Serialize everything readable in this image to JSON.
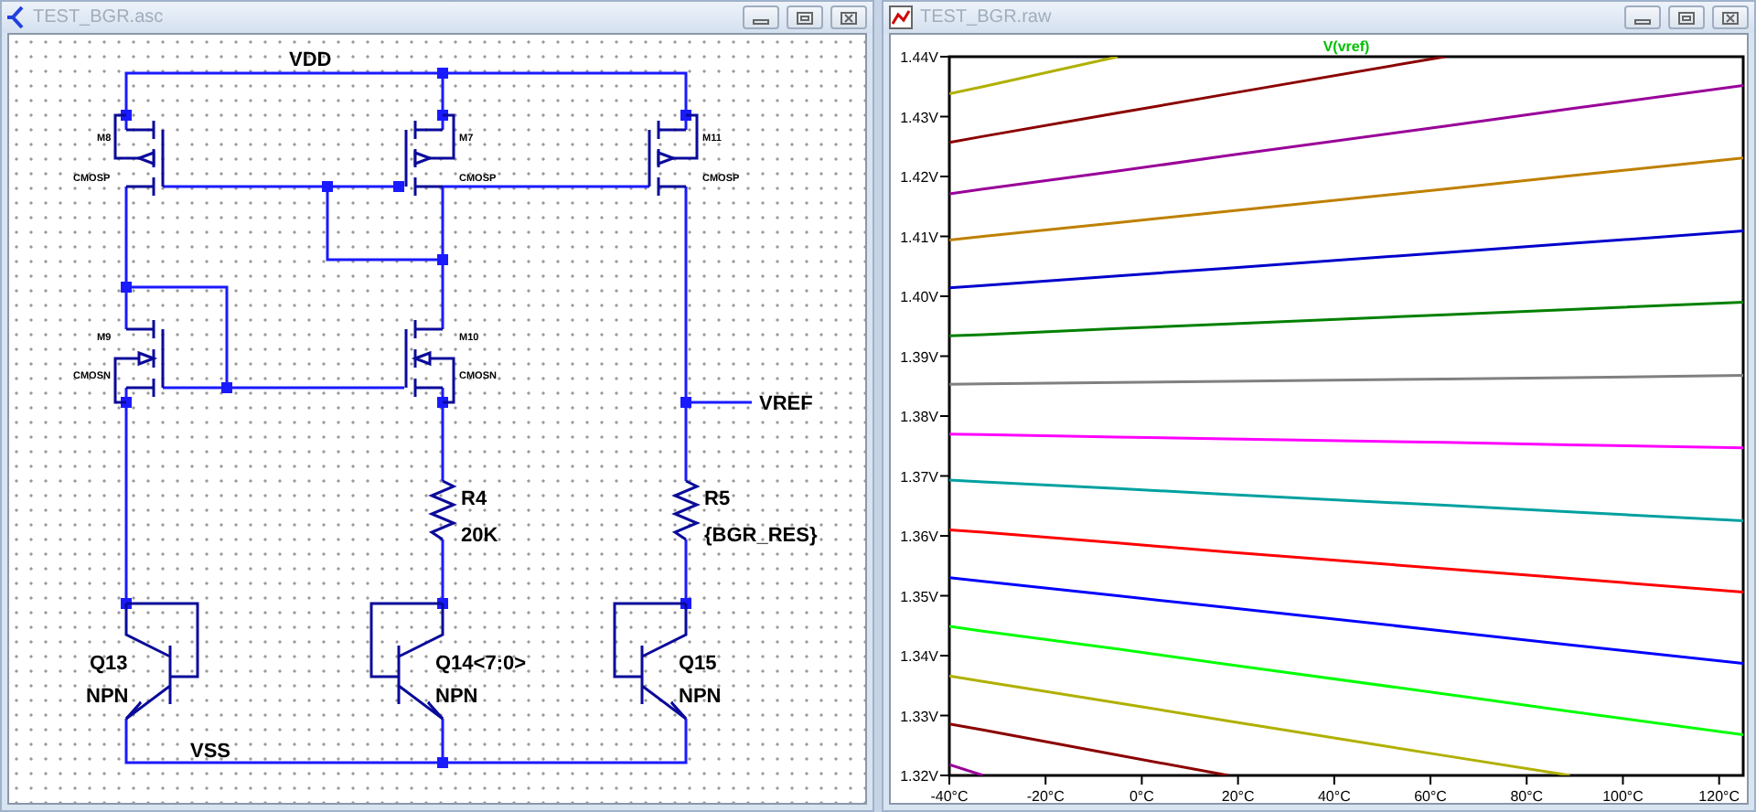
{
  "schematic_window": {
    "title": "TEST_BGR.asc",
    "net_labels": [
      {
        "text": "VDD"
      },
      {
        "text": "VREF"
      },
      {
        "text": "VSS"
      }
    ],
    "mosfets": [
      {
        "name": "M8",
        "model": "CMOSP",
        "kind": "pmos"
      },
      {
        "name": "M7",
        "model": "CMOSP",
        "kind": "pmos"
      },
      {
        "name": "M11",
        "model": "CMOSP",
        "kind": "pmos"
      },
      {
        "name": "M9",
        "model": "CMOSN",
        "kind": "nmos"
      },
      {
        "name": "M10",
        "model": "CMOSN",
        "kind": "nmos"
      }
    ],
    "resistors": [
      {
        "name": "R4",
        "value": "20K"
      },
      {
        "name": "R5",
        "value": "{BGR_RES}"
      }
    ],
    "bjts": [
      {
        "name": "Q13",
        "model": "NPN"
      },
      {
        "name": "Q14<7:0>",
        "model": "NPN"
      },
      {
        "name": "Q15",
        "model": "NPN"
      }
    ]
  },
  "plot_window": {
    "title": "TEST_BGR.raw",
    "chart_data": {
      "type": "line",
      "title": "V(vref)",
      "x": [
        -40,
        -33,
        -5,
        18,
        63,
        89,
        125
      ],
      "xlim": [
        -40,
        125
      ],
      "ylim": [
        1.32,
        1.44
      ],
      "xticks": [
        {
          "value": -40,
          "label": "-40°C"
        },
        {
          "value": -20,
          "label": "-20°C"
        },
        {
          "value": 0,
          "label": "0°C"
        },
        {
          "value": 20,
          "label": "20°C"
        },
        {
          "value": 40,
          "label": "40°C"
        },
        {
          "value": 60,
          "label": "60°C"
        },
        {
          "value": 80,
          "label": "80°C"
        },
        {
          "value": 100,
          "label": "100°C"
        },
        {
          "value": 120,
          "label": "120°C"
        }
      ],
      "yticks": [
        {
          "value": 1.32,
          "label": "1.32V"
        },
        {
          "value": 1.33,
          "label": "1.33V"
        },
        {
          "value": 1.34,
          "label": "1.34V"
        },
        {
          "value": 1.35,
          "label": "1.35V"
        },
        {
          "value": 1.36,
          "label": "1.36V"
        },
        {
          "value": 1.37,
          "label": "1.37V"
        },
        {
          "value": 1.38,
          "label": "1.38V"
        },
        {
          "value": 1.39,
          "label": "1.39V"
        },
        {
          "value": 1.4,
          "label": "1.40V"
        },
        {
          "value": 1.41,
          "label": "1.41V"
        },
        {
          "value": 1.42,
          "label": "1.42V"
        },
        {
          "value": 1.43,
          "label": "1.43V"
        },
        {
          "value": 1.44,
          "label": "1.44V"
        }
      ],
      "series": [
        {
          "color": "#b0b000",
          "values": [
            1.4338,
            1.435,
            1.44,
            null,
            null,
            null,
            null
          ]
        },
        {
          "color": "#8b0000",
          "values": [
            1.4257,
            1.4267,
            1.4306,
            1.4338,
            1.44,
            null,
            null
          ]
        },
        {
          "color": "#990099",
          "values": [
            1.4171,
            1.4179,
            1.4209,
            1.4235,
            1.4284,
            1.4313,
            1.4352
          ]
        },
        {
          "color": "#bf8000",
          "values": [
            1.4094,
            1.41,
            1.4123,
            1.4142,
            1.4179,
            1.4201,
            1.4231
          ]
        },
        {
          "color": "#0000cc",
          "values": [
            1.4014,
            1.4018,
            1.4034,
            1.4047,
            1.4073,
            1.4088,
            1.4109
          ]
        },
        {
          "color": "#008000",
          "values": [
            1.3934,
            1.3936,
            1.3946,
            1.3954,
            1.3969,
            1.3978,
            1.399
          ]
        },
        {
          "color": "#808080",
          "values": [
            1.3853,
            1.3854,
            1.3856,
            1.3858,
            1.3862,
            1.3864,
            1.3868
          ]
        },
        {
          "color": "#ff00ff",
          "values": [
            1.377,
            1.3769,
            1.3765,
            1.3762,
            1.3756,
            1.3752,
            1.3747
          ]
        },
        {
          "color": "#00a0a0",
          "values": [
            1.3693,
            1.369,
            1.3679,
            1.3669,
            1.3651,
            1.364,
            1.3625
          ]
        },
        {
          "color": "#ff0000",
          "values": [
            1.361,
            1.3606,
            1.3588,
            1.3573,
            1.3545,
            1.3529,
            1.3506
          ]
        },
        {
          "color": "#0000ff",
          "values": [
            1.353,
            1.3524,
            1.35,
            1.348,
            1.3441,
            1.3418,
            1.3387
          ]
        },
        {
          "color": "#00ff00",
          "values": [
            1.3449,
            1.3441,
            1.3411,
            1.3385,
            1.3336,
            1.3307,
            1.3268
          ]
        },
        {
          "color": "#b0b000",
          "values": [
            1.3366,
            1.3357,
            1.3321,
            1.3291,
            1.3233,
            1.32,
            null
          ]
        },
        {
          "color": "#8b0000",
          "values": [
            1.3286,
            1.3276,
            1.3234,
            1.32,
            null,
            null,
            null
          ]
        },
        {
          "color": "#990099",
          "values": [
            1.3218,
            1.32,
            null,
            null,
            null,
            null,
            null
          ]
        }
      ]
    }
  }
}
